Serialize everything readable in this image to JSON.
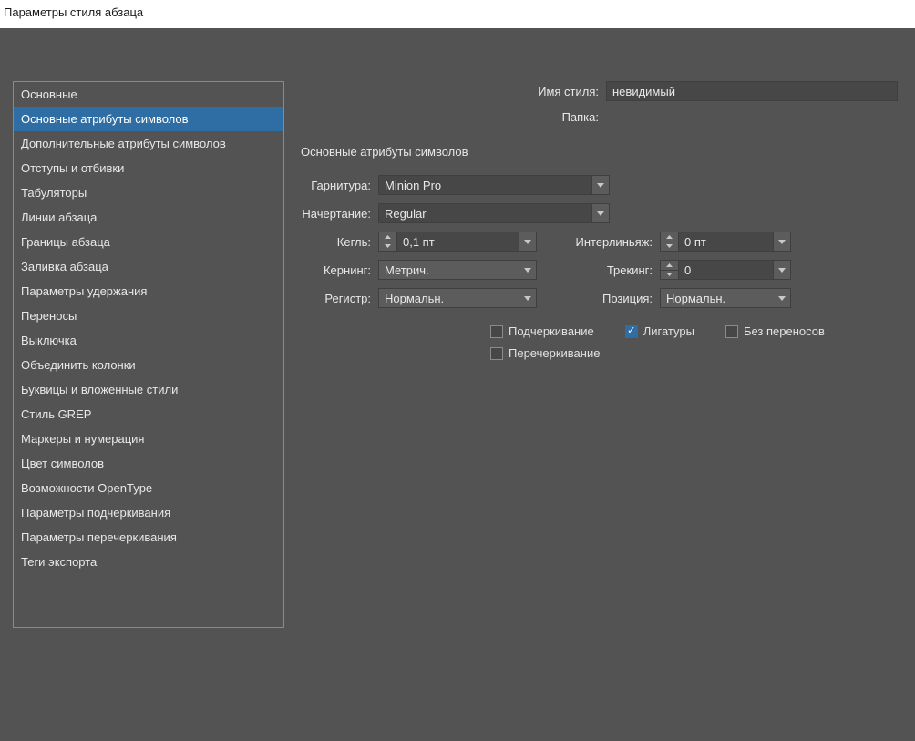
{
  "window": {
    "title": "Параметры стиля абзаца"
  },
  "sidebar": {
    "items": [
      {
        "label": "Основные"
      },
      {
        "label": "Основные атрибуты символов"
      },
      {
        "label": "Дополнительные атрибуты символов"
      },
      {
        "label": "Отступы и отбивки"
      },
      {
        "label": "Табуляторы"
      },
      {
        "label": "Линии абзаца"
      },
      {
        "label": "Границы абзаца"
      },
      {
        "label": "Заливка абзаца"
      },
      {
        "label": "Параметры удержания"
      },
      {
        "label": "Переносы"
      },
      {
        "label": "Выключка"
      },
      {
        "label": "Объединить колонки"
      },
      {
        "label": "Буквицы и вложенные стили"
      },
      {
        "label": "Стиль GREP"
      },
      {
        "label": "Маркеры и нумерация"
      },
      {
        "label": "Цвет символов"
      },
      {
        "label": "Возможности OpenType"
      },
      {
        "label": "Параметры подчеркивания"
      },
      {
        "label": "Параметры перечеркивания"
      },
      {
        "label": "Теги экспорта"
      }
    ],
    "selected_index": 1
  },
  "header": {
    "style_name_label": "Имя стиля:",
    "style_name_value": "невидимый",
    "folder_label": "Папка:"
  },
  "section_title": "Основные атрибуты символов",
  "fields": {
    "font_family_label": "Гарнитура:",
    "font_family_value": "Minion Pro",
    "font_style_label": "Начертание:",
    "font_style_value": "Regular",
    "size_label": "Кегль:",
    "size_value": "0,1 пт",
    "leading_label": "Интерлиньяж:",
    "leading_value": "0 пт",
    "kerning_label": "Кернинг:",
    "kerning_value": "Метрич.",
    "tracking_label": "Трекинг:",
    "tracking_value": "0",
    "case_label": "Регистр:",
    "case_value": "Нормальн.",
    "position_label": "Позиция:",
    "position_value": "Нормальн."
  },
  "checkboxes": {
    "underline": {
      "label": "Подчеркивание",
      "checked": false
    },
    "ligatures": {
      "label": "Лигатуры",
      "checked": true
    },
    "nobreak": {
      "label": "Без переносов",
      "checked": false
    },
    "strikethrough": {
      "label": "Перечеркивание",
      "checked": false
    }
  }
}
